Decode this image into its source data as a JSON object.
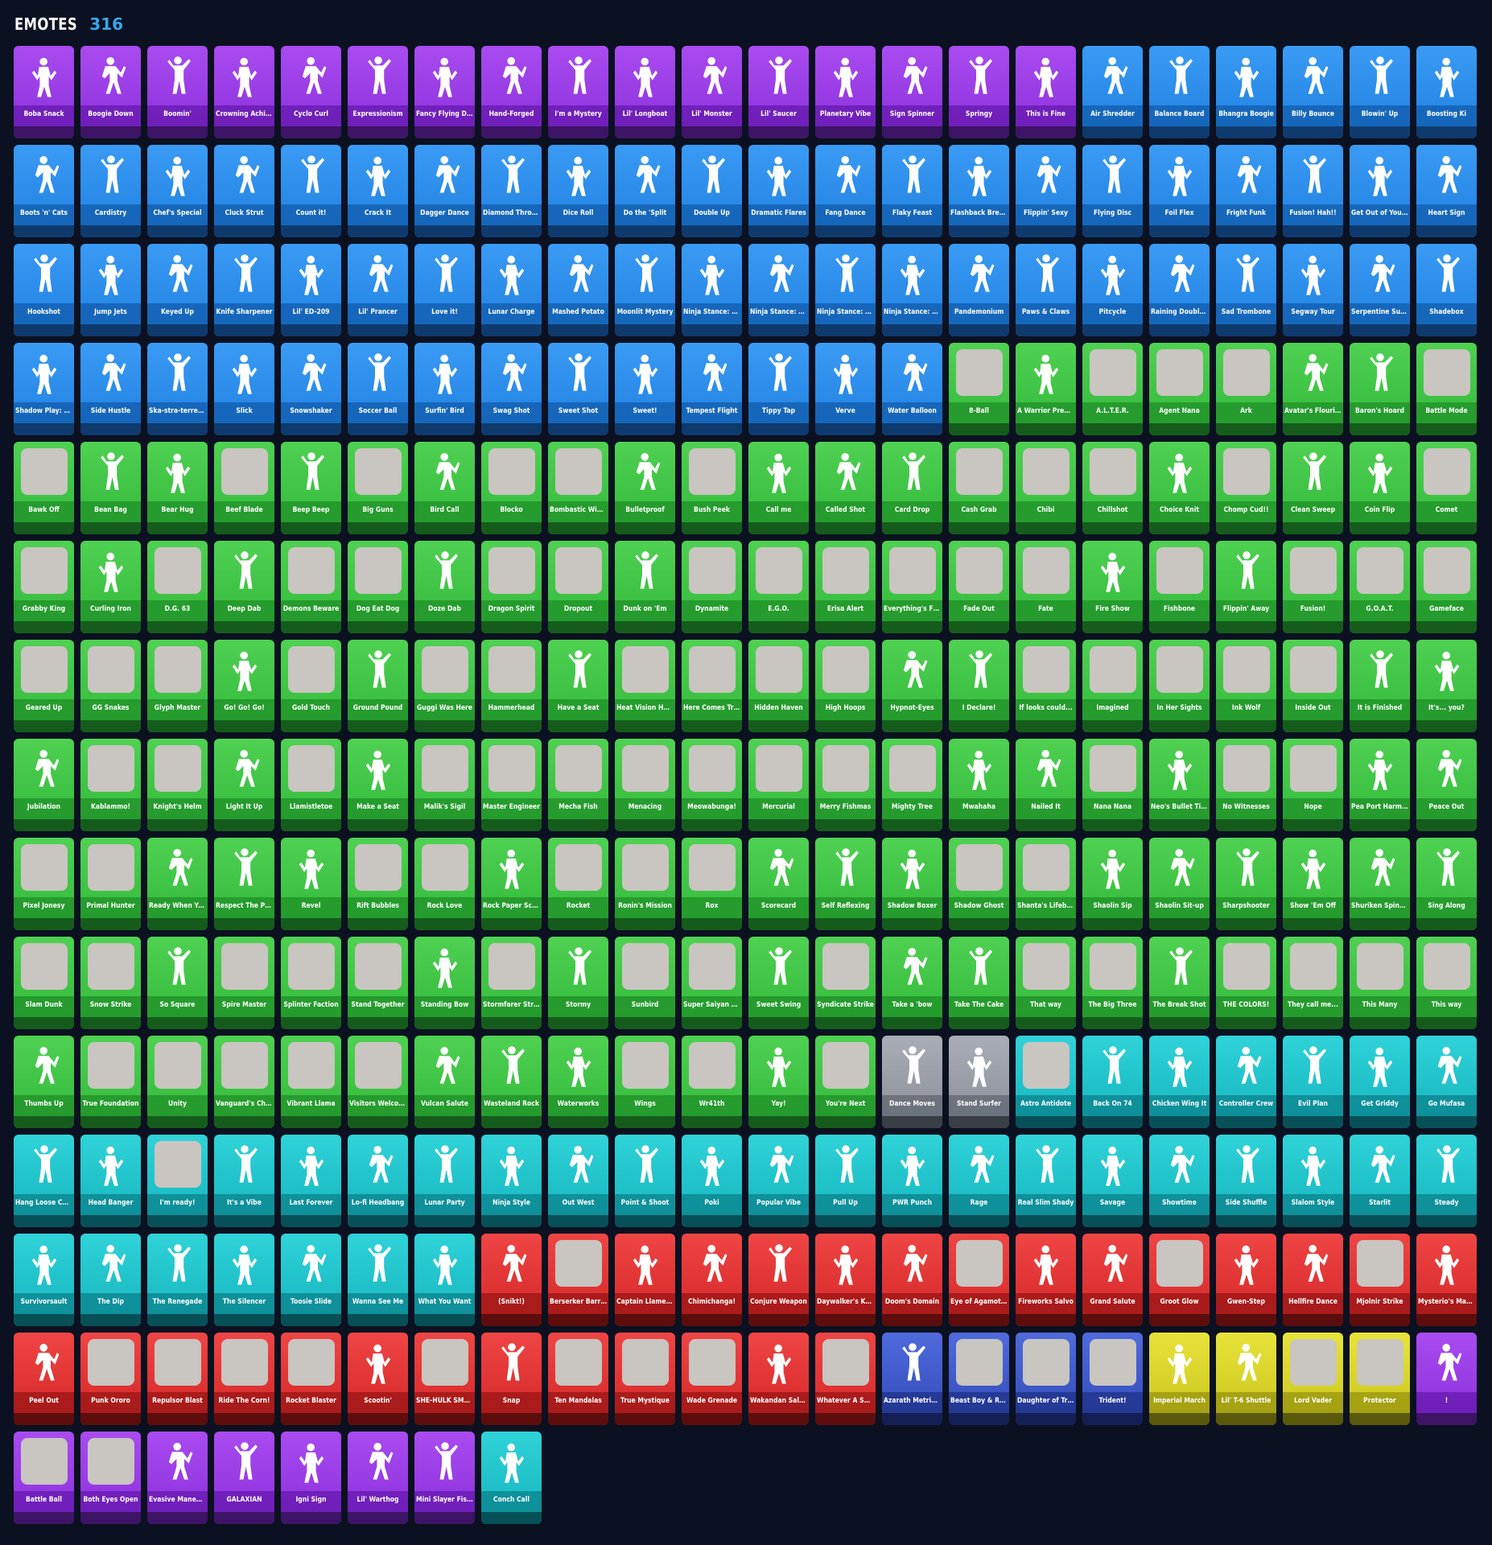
{
  "header": {
    "title": "EMOTES",
    "count": "316"
  },
  "colors": {
    "epic": "#a94bf0",
    "rare": "#3a9bf5",
    "uncommon": "#4fd152",
    "icon": "#2fd3d8",
    "marvel": "#f04545",
    "dc": "#4f6bdc",
    "starwars": "#e8e33a",
    "common": "#a9adb5",
    "count": "#36a8f0"
  },
  "emotes": [
    {
      "n": "Boba Snack",
      "r": "epic"
    },
    {
      "n": "Boogie Down",
      "r": "epic"
    },
    {
      "n": "Boomin'",
      "r": "epic"
    },
    {
      "n": "Crowning Achieve...",
      "r": "epic"
    },
    {
      "n": "Cyclo Curl",
      "r": "epic"
    },
    {
      "n": "Expressionism",
      "r": "epic"
    },
    {
      "n": "Fancy Flying Disc",
      "r": "epic"
    },
    {
      "n": "Hand-Forged",
      "r": "epic"
    },
    {
      "n": "I'm a Mystery",
      "r": "epic"
    },
    {
      "n": "Lil' Longboat",
      "r": "epic"
    },
    {
      "n": "Lil' Monster",
      "r": "epic"
    },
    {
      "n": "Lil' Saucer",
      "r": "epic"
    },
    {
      "n": "Planetary Vibe",
      "r": "epic"
    },
    {
      "n": "Sign Spinner",
      "r": "epic"
    },
    {
      "n": "Springy",
      "r": "epic"
    },
    {
      "n": "This is Fine",
      "r": "epic"
    },
    {
      "n": "Air Shredder",
      "r": "rare"
    },
    {
      "n": "Balance Board",
      "r": "rare"
    },
    {
      "n": "Bhangra Boogie",
      "r": "rare"
    },
    {
      "n": "Billy Bounce",
      "r": "rare"
    },
    {
      "n": "Blowin' Up",
      "r": "rare"
    },
    {
      "n": "Boosting Ki",
      "r": "rare"
    },
    {
      "n": "Boots 'n' Cats",
      "r": "rare"
    },
    {
      "n": "Cardistry",
      "r": "rare"
    },
    {
      "n": "Chef's Special",
      "r": "rare"
    },
    {
      "n": "Cluck Strut",
      "r": "rare"
    },
    {
      "n": "Count it!",
      "r": "rare"
    },
    {
      "n": "Crack It",
      "r": "rare"
    },
    {
      "n": "Dagger Dance",
      "r": "rare"
    },
    {
      "n": "Diamond Throne",
      "r": "rare"
    },
    {
      "n": "Dice Roll",
      "r": "rare"
    },
    {
      "n": "Do the 'Split",
      "r": "rare"
    },
    {
      "n": "Double Up",
      "r": "rare"
    },
    {
      "n": "Dramatic Flares",
      "r": "rare"
    },
    {
      "n": "Fang Dance",
      "r": "rare"
    },
    {
      "n": "Flaky Feast",
      "r": "rare"
    },
    {
      "n": "Flashback Breakd...",
      "r": "rare"
    },
    {
      "n": "Flippin' Sexy",
      "r": "rare"
    },
    {
      "n": "Flying Disc",
      "r": "rare"
    },
    {
      "n": "Foil Flex",
      "r": "rare"
    },
    {
      "n": "Fright Funk",
      "r": "rare"
    },
    {
      "n": "Fusion! Hah!!",
      "r": "rare"
    },
    {
      "n": "Get Out of Your M...",
      "r": "rare"
    },
    {
      "n": "Heart Sign",
      "r": "rare"
    },
    {
      "n": "Hookshot",
      "r": "rare"
    },
    {
      "n": "Jump Jets",
      "r": "rare"
    },
    {
      "n": "Keyed Up",
      "r": "rare"
    },
    {
      "n": "Knife Sharpener",
      "r": "rare"
    },
    {
      "n": "Lil' ED-209",
      "r": "rare"
    },
    {
      "n": "Lil' Prancer",
      "r": "rare"
    },
    {
      "n": "Love it!",
      "r": "rare"
    },
    {
      "n": "Lunar Charge",
      "r": "rare"
    },
    {
      "n": "Mashed Potato",
      "r": "rare"
    },
    {
      "n": "Moonlit Mystery",
      "r": "rare"
    },
    {
      "n": "Ninja Stance: Don...",
      "r": "rare"
    },
    {
      "n": "Ninja Stance: Leo",
      "r": "rare"
    },
    {
      "n": "Ninja Stance: Mik...",
      "r": "rare"
    },
    {
      "n": "Ninja Stance: Raph",
      "r": "rare"
    },
    {
      "n": "Pandemonium",
      "r": "rare"
    },
    {
      "n": "Paws & Claws",
      "r": "rare"
    },
    {
      "n": "Pitcycle",
      "r": "rare"
    },
    {
      "n": "Raining Doubloons",
      "r": "rare"
    },
    {
      "n": "Sad Trombone",
      "r": "rare"
    },
    {
      "n": "Segway Tour",
      "r": "rare"
    },
    {
      "n": "Serpentine Summ...",
      "r": "rare"
    },
    {
      "n": "Shadebox",
      "r": "rare"
    },
    {
      "n": "Shadow Play: Toad",
      "r": "rare"
    },
    {
      "n": "Side Hustle",
      "r": "rare"
    },
    {
      "n": "Ska-stra-terrestri...",
      "r": "rare"
    },
    {
      "n": "Slick",
      "r": "rare"
    },
    {
      "n": "Snowshaker",
      "r": "rare"
    },
    {
      "n": "Soccer Ball",
      "r": "rare"
    },
    {
      "n": "Surfin' Bird",
      "r": "rare"
    },
    {
      "n": "Swag Shot",
      "r": "rare"
    },
    {
      "n": "Sweet Shot",
      "r": "rare"
    },
    {
      "n": "Sweet!",
      "r": "rare"
    },
    {
      "n": "Tempest Flight",
      "r": "rare"
    },
    {
      "n": "Tippy Tap",
      "r": "rare"
    },
    {
      "n": "Verve",
      "r": "rare"
    },
    {
      "n": "Water Balloon",
      "r": "rare"
    },
    {
      "n": "8-Ball",
      "r": "unc",
      "s": 1
    },
    {
      "n": "A Warrior Prepares",
      "r": "unc"
    },
    {
      "n": "A.L.T.E.R.",
      "r": "unc",
      "s": 1
    },
    {
      "n": "Agent Nana",
      "r": "unc",
      "s": 1
    },
    {
      "n": "Ark",
      "r": "unc",
      "s": 1
    },
    {
      "n": "Avatar's Flourish",
      "r": "unc"
    },
    {
      "n": "Baron's Hoard",
      "r": "unc"
    },
    {
      "n": "Battle Mode",
      "r": "unc",
      "s": 1
    },
    {
      "n": "Bawk Off",
      "r": "unc",
      "s": 1
    },
    {
      "n": "Bean Bag",
      "r": "unc"
    },
    {
      "n": "Bear Hug",
      "r": "unc"
    },
    {
      "n": "Beef Blade",
      "r": "unc",
      "s": 1
    },
    {
      "n": "Beep Beep",
      "r": "unc"
    },
    {
      "n": "Big Guns",
      "r": "unc",
      "s": 1
    },
    {
      "n": "Bird Call",
      "r": "unc"
    },
    {
      "n": "Blocko",
      "r": "unc",
      "s": 1
    },
    {
      "n": "Bombastic Winter...",
      "r": "unc",
      "s": 1
    },
    {
      "n": "Bulletproof",
      "r": "unc"
    },
    {
      "n": "Bush Peek",
      "r": "unc",
      "s": 1
    },
    {
      "n": "Call me",
      "r": "unc"
    },
    {
      "n": "Called Shot",
      "r": "unc"
    },
    {
      "n": "Card Drop",
      "r": "unc"
    },
    {
      "n": "Cash Grab",
      "r": "unc",
      "s": 1
    },
    {
      "n": "Chibi",
      "r": "unc",
      "s": 1
    },
    {
      "n": "Chillshot",
      "r": "unc",
      "s": 1
    },
    {
      "n": "Choice Knit",
      "r": "unc"
    },
    {
      "n": "Chomp Cud!!",
      "r": "unc",
      "s": 1
    },
    {
      "n": "Clean Sweep",
      "r": "unc"
    },
    {
      "n": "Coin Flip",
      "r": "unc"
    },
    {
      "n": "Comet",
      "r": "unc",
      "s": 1
    },
    {
      "n": "Grabby King",
      "r": "unc",
      "s": 1
    },
    {
      "n": "Curling Iron",
      "r": "unc"
    },
    {
      "n": "D.G. 63",
      "r": "unc",
      "s": 1
    },
    {
      "n": "Deep Dab",
      "r": "unc"
    },
    {
      "n": "Demons Beware",
      "r": "unc",
      "s": 1
    },
    {
      "n": "Dog Eat Dog",
      "r": "unc",
      "s": 1
    },
    {
      "n": "Doze Dab",
      "r": "unc"
    },
    {
      "n": "Dragon Spirit",
      "r": "unc",
      "s": 1
    },
    {
      "n": "Dropout",
      "r": "unc",
      "s": 1
    },
    {
      "n": "Dunk on 'Em",
      "r": "unc"
    },
    {
      "n": "Dynamite",
      "r": "unc",
      "s": 1
    },
    {
      "n": "E.G.O.",
      "r": "unc",
      "s": 1
    },
    {
      "n": "Erisa Alert",
      "r": "unc",
      "s": 1
    },
    {
      "n": "Everything's Fine",
      "r": "unc",
      "s": 1
    },
    {
      "n": "Fade Out",
      "r": "unc",
      "s": 1
    },
    {
      "n": "Fate",
      "r": "unc",
      "s": 1
    },
    {
      "n": "Fire Show",
      "r": "unc"
    },
    {
      "n": "Fishbone",
      "r": "unc",
      "s": 1
    },
    {
      "n": "Flippin' Away",
      "r": "unc"
    },
    {
      "n": "Fusion!",
      "r": "unc",
      "s": 1
    },
    {
      "n": "G.O.A.T.",
      "r": "unc",
      "s": 1
    },
    {
      "n": "Gameface",
      "r": "unc",
      "s": 1
    },
    {
      "n": "Geared Up",
      "r": "unc",
      "s": 1
    },
    {
      "n": "GG Snakes",
      "r": "unc",
      "s": 1
    },
    {
      "n": "Glyph Master",
      "r": "unc",
      "s": 1
    },
    {
      "n": "Go! Go! Go!",
      "r": "unc"
    },
    {
      "n": "Gold Touch",
      "r": "unc",
      "s": 1
    },
    {
      "n": "Ground Pound",
      "r": "unc"
    },
    {
      "n": "Guggi Was Here",
      "r": "unc",
      "s": 1
    },
    {
      "n": "Hammerhead",
      "r": "unc",
      "s": 1
    },
    {
      "n": "Have a Seat",
      "r": "unc"
    },
    {
      "n": "Heat Vision Hunter",
      "r": "unc",
      "s": 1
    },
    {
      "n": "Here Comes Trubb...",
      "r": "unc",
      "s": 1
    },
    {
      "n": "Hidden Haven",
      "r": "unc",
      "s": 1
    },
    {
      "n": "High Hoops",
      "r": "unc",
      "s": 1
    },
    {
      "n": "Hypnot-Eyes",
      "r": "unc"
    },
    {
      "n": "I Declare!",
      "r": "unc"
    },
    {
      "n": "If looks could...",
      "r": "unc",
      "s": 1
    },
    {
      "n": "Imagined",
      "r": "unc",
      "s": 1
    },
    {
      "n": "In Her Sights",
      "r": "unc",
      "s": 1
    },
    {
      "n": "Ink Wolf",
      "r": "unc",
      "s": 1
    },
    {
      "n": "Inside Out",
      "r": "unc",
      "s": 1
    },
    {
      "n": "It is Finished",
      "r": "unc"
    },
    {
      "n": "It's... you?",
      "r": "unc"
    },
    {
      "n": "Jubilation",
      "r": "unc"
    },
    {
      "n": "Kablammo!",
      "r": "unc",
      "s": 1
    },
    {
      "n": "Knight's Helm",
      "r": "unc",
      "s": 1
    },
    {
      "n": "Light It Up",
      "r": "unc"
    },
    {
      "n": "Llamistletoe",
      "r": "unc",
      "s": 1
    },
    {
      "n": "Make a Seat",
      "r": "unc"
    },
    {
      "n": "Malik's Sigil",
      "r": "unc",
      "s": 1
    },
    {
      "n": "Master Engineer",
      "r": "unc",
      "s": 1
    },
    {
      "n": "Mecha Fish",
      "r": "unc",
      "s": 1
    },
    {
      "n": "Menacing",
      "r": "unc",
      "s": 1
    },
    {
      "n": "Meowabunga!",
      "r": "unc",
      "s": 1
    },
    {
      "n": "Mercurial",
      "r": "unc",
      "s": 1
    },
    {
      "n": "Merry Fishmas",
      "r": "unc",
      "s": 1
    },
    {
      "n": "Mighty Tree",
      "r": "unc",
      "s": 1
    },
    {
      "n": "Mwahaha",
      "r": "unc"
    },
    {
      "n": "Nailed It",
      "r": "unc"
    },
    {
      "n": "Nana Nana",
      "r": "unc",
      "s": 1
    },
    {
      "n": "Neo's Bullet Time",
      "r": "unc"
    },
    {
      "n": "No Witnesses",
      "r": "unc",
      "s": 1
    },
    {
      "n": "Nope",
      "r": "unc",
      "s": 1
    },
    {
      "n": "Pea Port Harmony",
      "r": "unc"
    },
    {
      "n": "Peace Out",
      "r": "unc"
    },
    {
      "n": "Pixel Jonesy",
      "r": "unc",
      "s": 1
    },
    {
      "n": "Primal Hunter",
      "r": "unc",
      "s": 1
    },
    {
      "n": "Ready When You ...",
      "r": "unc"
    },
    {
      "n": "Respect The Peace",
      "r": "unc"
    },
    {
      "n": "Revel",
      "r": "unc"
    },
    {
      "n": "Rift Bubbles",
      "r": "unc",
      "s": 1
    },
    {
      "n": "Rock Love",
      "r": "unc",
      "s": 1
    },
    {
      "n": "Rock Paper Sciss...",
      "r": "unc"
    },
    {
      "n": "Rocket",
      "r": "unc",
      "s": 1
    },
    {
      "n": "Ronin's Mission",
      "r": "unc",
      "s": 1
    },
    {
      "n": "Rox",
      "r": "unc",
      "s": 1
    },
    {
      "n": "Scorecard",
      "r": "unc"
    },
    {
      "n": "Self Reflexing",
      "r": "unc"
    },
    {
      "n": "Shadow Boxer",
      "r": "unc"
    },
    {
      "n": "Shadow Ghost",
      "r": "unc",
      "s": 1
    },
    {
      "n": "Shanta's Lifebloom",
      "r": "unc",
      "s": 1
    },
    {
      "n": "Shaolin Sip",
      "r": "unc"
    },
    {
      "n": "Shaolin Sit-up",
      "r": "unc"
    },
    {
      "n": "Sharpshooter",
      "r": "unc"
    },
    {
      "n": "Show 'Em Off",
      "r": "unc"
    },
    {
      "n": "Shuriken Spinner",
      "r": "unc"
    },
    {
      "n": "Sing Along",
      "r": "unc"
    },
    {
      "n": "Slam Dunk",
      "r": "unc",
      "s": 1
    },
    {
      "n": "Snow Strike",
      "r": "unc",
      "s": 1
    },
    {
      "n": "So Square",
      "r": "unc"
    },
    {
      "n": "Spire Master",
      "r": "unc",
      "s": 1
    },
    {
      "n": "Splinter Faction",
      "r": "unc",
      "s": 1
    },
    {
      "n": "Stand Together",
      "r": "unc",
      "s": 1
    },
    {
      "n": "Standing Bow",
      "r": "unc"
    },
    {
      "n": "Stormfarer Strike",
      "r": "unc",
      "s": 1
    },
    {
      "n": "Stormy",
      "r": "unc"
    },
    {
      "n": "Sunbird",
      "r": "unc",
      "s": 1
    },
    {
      "n": "Super Saiyan Blu...",
      "r": "unc",
      "s": 1
    },
    {
      "n": "Sweet Swing",
      "r": "unc"
    },
    {
      "n": "Syndicate Strike",
      "r": "unc",
      "s": 1
    },
    {
      "n": "Take a 'bow",
      "r": "unc"
    },
    {
      "n": "Take The Cake",
      "r": "unc"
    },
    {
      "n": "That way",
      "r": "unc",
      "s": 1
    },
    {
      "n": "The Big Three",
      "r": "unc",
      "s": 1
    },
    {
      "n": "The Break Shot",
      "r": "unc"
    },
    {
      "n": "THE COLORS!",
      "r": "unc",
      "s": 1
    },
    {
      "n": "They call me...",
      "r": "unc",
      "s": 1
    },
    {
      "n": "This Many",
      "r": "unc",
      "s": 1
    },
    {
      "n": "This way",
      "r": "unc",
      "s": 1
    },
    {
      "n": "Thumbs Up",
      "r": "unc"
    },
    {
      "n": "True Foundation",
      "r": "unc",
      "s": 1
    },
    {
      "n": "Unity",
      "r": "unc",
      "s": 1
    },
    {
      "n": "Vanguard's Charge",
      "r": "unc",
      "s": 1
    },
    {
      "n": "Vibrant Llama",
      "r": "unc",
      "s": 1
    },
    {
      "n": "Visitors Welcome",
      "r": "unc",
      "s": 1
    },
    {
      "n": "Vulcan Salute",
      "r": "unc"
    },
    {
      "n": "Wasteland Rock",
      "r": "unc"
    },
    {
      "n": "Waterworks",
      "r": "unc"
    },
    {
      "n": "Wings",
      "r": "unc",
      "s": 1
    },
    {
      "n": "Wr41th",
      "r": "unc",
      "s": 1
    },
    {
      "n": "Yay!",
      "r": "unc"
    },
    {
      "n": "You're Next",
      "r": "unc",
      "s": 1
    },
    {
      "n": "Dance Moves",
      "r": "common"
    },
    {
      "n": "Stand Surfer",
      "r": "common"
    },
    {
      "n": "Astro Antidote",
      "r": "icon",
      "s": 1
    },
    {
      "n": "Back On 74",
      "r": "icon"
    },
    {
      "n": "Chicken Wing It",
      "r": "icon"
    },
    {
      "n": "Controller Crew",
      "r": "icon"
    },
    {
      "n": "Evil Plan",
      "r": "icon"
    },
    {
      "n": "Get Griddy",
      "r": "icon"
    },
    {
      "n": "Go Mufasa",
      "r": "icon"
    },
    {
      "n": "Hang Loose Celeb...",
      "r": "icon"
    },
    {
      "n": "Head Banger",
      "r": "icon"
    },
    {
      "n": "I'm ready!",
      "r": "icon",
      "s": 1
    },
    {
      "n": "It's a Vibe",
      "r": "icon"
    },
    {
      "n": "Last Forever",
      "r": "icon"
    },
    {
      "n": "Lo-fi Headbang",
      "r": "icon"
    },
    {
      "n": "Lunar Party",
      "r": "icon"
    },
    {
      "n": "Ninja Style",
      "r": "icon"
    },
    {
      "n": "Out West",
      "r": "icon"
    },
    {
      "n": "Point & Shoot",
      "r": "icon"
    },
    {
      "n": "Poki",
      "r": "icon"
    },
    {
      "n": "Popular Vibe",
      "r": "icon"
    },
    {
      "n": "Pull Up",
      "r": "icon"
    },
    {
      "n": "PWR Punch",
      "r": "icon"
    },
    {
      "n": "Rage",
      "r": "icon"
    },
    {
      "n": "Real Slim Shady",
      "r": "icon"
    },
    {
      "n": "Savage",
      "r": "icon"
    },
    {
      "n": "Showtime",
      "r": "icon"
    },
    {
      "n": "Side Shuffle",
      "r": "icon"
    },
    {
      "n": "Slalom Style",
      "r": "icon"
    },
    {
      "n": "Starlit",
      "r": "icon"
    },
    {
      "n": "Steady",
      "r": "icon"
    },
    {
      "n": "Survivorsault",
      "r": "icon"
    },
    {
      "n": "The Dip",
      "r": "icon"
    },
    {
      "n": "The Renegade",
      "r": "icon"
    },
    {
      "n": "The Silencer",
      "r": "icon"
    },
    {
      "n": "Toosie Slide",
      "r": "icon"
    },
    {
      "n": "Wanna See Me",
      "r": "icon"
    },
    {
      "n": "What You Want",
      "r": "icon"
    },
    {
      "n": "(Snikt!)",
      "r": "marvel"
    },
    {
      "n": "Berserker Barrage!",
      "r": "marvel",
      "s": 1
    },
    {
      "n": "Captain Llamerica",
      "r": "marvel"
    },
    {
      "n": "Chimichanga!",
      "r": "marvel"
    },
    {
      "n": "Conjure Weapon",
      "r": "marvel"
    },
    {
      "n": "Daywalker's Kata",
      "r": "marvel"
    },
    {
      "n": "Doom's Domain",
      "r": "marvel"
    },
    {
      "n": "Eye of Agamotto",
      "r": "marvel",
      "s": 1
    },
    {
      "n": "Fireworks Salvo",
      "r": "marvel"
    },
    {
      "n": "Grand Salute",
      "r": "marvel"
    },
    {
      "n": "Groot Glow",
      "r": "marvel",
      "s": 1
    },
    {
      "n": "Gwen-Step",
      "r": "marvel"
    },
    {
      "n": "Hellfire Dance",
      "r": "marvel"
    },
    {
      "n": "Mjolnir Strike",
      "r": "marvel",
      "s": 1
    },
    {
      "n": "Mysterio's Magic ...",
      "r": "marvel"
    },
    {
      "n": "Peel Out",
      "r": "marvel"
    },
    {
      "n": "Punk Ororo",
      "r": "marvel",
      "s": 1
    },
    {
      "n": "Repulsor Blast",
      "r": "marvel",
      "s": 1
    },
    {
      "n": "Ride The Corn!",
      "r": "marvel",
      "s": 1
    },
    {
      "n": "Rocket Blaster",
      "r": "marvel",
      "s": 1
    },
    {
      "n": "Scootin'",
      "r": "marvel"
    },
    {
      "n": "SHE-HULK SMASH",
      "r": "marvel",
      "s": 1
    },
    {
      "n": "Snap",
      "r": "marvel"
    },
    {
      "n": "Ten Mandalas",
      "r": "marvel",
      "s": 1
    },
    {
      "n": "True Mystique",
      "r": "marvel",
      "s": 1
    },
    {
      "n": "Wade Grenade",
      "r": "marvel",
      "s": 1
    },
    {
      "n": "Wakandan Salute",
      "r": "marvel"
    },
    {
      "n": "Whatever A Spide...",
      "r": "marvel",
      "s": 1
    },
    {
      "n": "Azarath Metrion Z...",
      "r": "dc"
    },
    {
      "n": "Beast Boy & Raven",
      "r": "dc",
      "s": 1
    },
    {
      "n": "Daughter of Trigon",
      "r": "dc",
      "s": 1
    },
    {
      "n": "Trident!",
      "r": "dc",
      "s": 1
    },
    {
      "n": "Imperial March",
      "r": "sw"
    },
    {
      "n": "Lil' T-6 Shuttle",
      "r": "sw"
    },
    {
      "n": "Lord Vader",
      "r": "sw",
      "s": 1
    },
    {
      "n": "Protector",
      "r": "sw",
      "s": 1
    },
    {
      "n": "!",
      "r": "epic"
    },
    {
      "n": "Battle Ball",
      "r": "epic",
      "s": 1
    },
    {
      "n": "Both Eyes Open",
      "r": "epic",
      "s": 1
    },
    {
      "n": "Evasive Maneuvers",
      "r": "epic"
    },
    {
      "n": "GALAXIAN",
      "r": "epic"
    },
    {
      "n": "Igni Sign",
      "r": "epic"
    },
    {
      "n": "Lil' Warthog",
      "r": "epic"
    },
    {
      "n": "Mini Slayer Fistbu...",
      "r": "epic"
    },
    {
      "n": "Conch Call",
      "r": "icon"
    }
  ]
}
